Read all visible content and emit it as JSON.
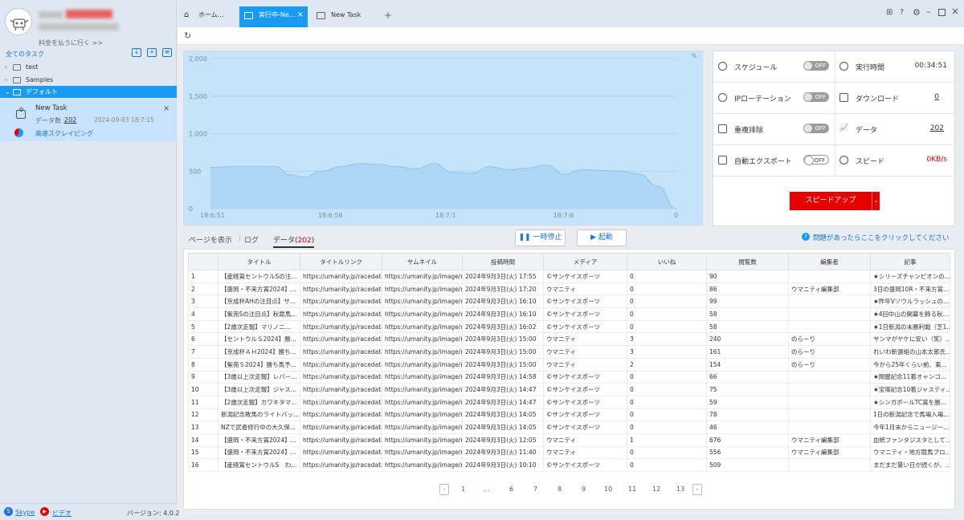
{
  "sidebar": {
    "pay_link": "料金を払うに行く >>",
    "all_tasks": "全てのタスク",
    "tree": [
      {
        "label": "test"
      },
      {
        "label": "Samples"
      },
      {
        "label": "デフォルト"
      }
    ],
    "task": {
      "name": "New Task",
      "data_label": "データ数 :",
      "data_count": "202",
      "timestamp": "2024-09-03 18:7:15",
      "mode": "高速スクレイピング"
    },
    "footer": {
      "skype": "Skype",
      "video": "ビデオ",
      "version": "バージョン: 4.0.2"
    }
  },
  "tabs": [
    {
      "label": "ホーム..."
    },
    {
      "label": "実行中-Ne..."
    },
    {
      "label": "New Task"
    }
  ],
  "stats": {
    "schedule": {
      "label": "スケジュール",
      "toggle": "OFF"
    },
    "runtime": {
      "label": "実行時間",
      "value": "00:34:51"
    },
    "ip_rotation": {
      "label": "IPローテーション",
      "toggle": "OFF"
    },
    "download": {
      "label": "ダウンロード",
      "value": "0"
    },
    "dedupe": {
      "label": "重複排除",
      "toggle": "OFF"
    },
    "data": {
      "label": "データ",
      "value": "202"
    },
    "auto_export": {
      "label": "自動エクスポート",
      "toggle": "OFF"
    },
    "speed": {
      "label": "スピード",
      "value": "0KB/s"
    },
    "speedup_button": "スピードアップ"
  },
  "subtabs": {
    "show_page": "ページを表示",
    "log": "ログ",
    "data_prefix": "データ(",
    "data_count": "202",
    "data_suffix": ")",
    "pause": "一時停止",
    "start": "起動",
    "help": "問題があったらここをクリックしてください"
  },
  "table": {
    "headers": [
      "",
      "タイトル",
      "タイトルリンク",
      "サムネイル",
      "投稿時間",
      "メディア",
      "いいね",
      "閲覧数",
      "編集者",
      "記事"
    ],
    "rows": [
      [
        "1",
        "【産経賞セントウルSの注...",
        "https://umanity.jp/racedata/...",
        "https://umanity.jp/image/ne...",
        "2024年9月3日(火) 17:55",
        "©サンケイスポーツ",
        "0",
        "90",
        "",
        "★シリーズチャンピオンの..."
      ],
      [
        "2",
        "【盛岡・不来方賞2024】...",
        "https://umanity.jp/racedata/...",
        "https://umanity.jp/image/ne...",
        "2024年9月3日(火) 17:20",
        "ウマニティ",
        "0",
        "86",
        "ウマニティ編集部",
        "3日の盛岡10R・不来方賞..."
      ],
      [
        "3",
        "【京成杯AHの注目点】サ...",
        "https://umanity.jp/racedata/...",
        "https://umanity.jp/image/ne...",
        "2024年9月3日(火) 16:10",
        "©サンケイスポーツ",
        "0",
        "99",
        "",
        "★昨年Vソウルラッシュの..."
      ],
      [
        "4",
        "【紫苑Sの注目点】秋競馬...",
        "https://umanity.jp/racedata/...",
        "https://umanity.jp/image/ne...",
        "2024年9月3日(火) 16:10",
        "©サンケイスポーツ",
        "0",
        "58",
        "",
        "★4回中山の開幕を飾る秋..."
      ],
      [
        "5",
        "【2歳次走報】マリノニ...",
        "https://umanity.jp/racedata/...",
        "https://umanity.jp/image/ne...",
        "2024年9月3日(火) 16:02",
        "©サンケイスポーツ",
        "0",
        "58",
        "",
        "★1日新潟の未勝利戦（芝1..."
      ],
      [
        "6",
        "【セントウルＳ2024】勝...",
        "https://umanity.jp/racedata/...",
        "https://umanity.jp/image/ne...",
        "2024年9月3日(火) 15:00",
        "ウマニティ",
        "3",
        "240",
        "のらーり",
        "サンマがヤケに安い（笑）..."
      ],
      [
        "7",
        "【京成杯ＡＨ2024】勝ち...",
        "https://umanity.jp/racedata/...",
        "https://umanity.jp/image/ne...",
        "2024年9月3日(火) 15:00",
        "ウマニティ",
        "3",
        "161",
        "のらーり",
        "れいわ新選組の山本太郎氏..."
      ],
      [
        "8",
        "【紫苑Ｓ2024】勝ち馬予...",
        "https://umanity.jp/racedata/...",
        "https://umanity.jp/image/ne...",
        "2024年9月3日(火) 15:00",
        "ウマニティ",
        "2",
        "154",
        "のらーり",
        "今から25年くらい前、東..."
      ],
      [
        "9",
        "【3歳以上次走報】レパー...",
        "https://umanity.jp/racedata/...",
        "https://umanity.jp/image/ne...",
        "2024年9月3日(火) 14:58",
        "©サンケイスポーツ",
        "0",
        "66",
        "",
        "★関屋記念11着オャンコ..."
      ],
      [
        "10",
        "【3歳以上次走報】ジャス...",
        "https://umanity.jp/racedata/...",
        "https://umanity.jp/image/ne...",
        "2024年9月3日(火) 14:47",
        "©サンケイスポーツ",
        "0",
        "75",
        "",
        "★宝塚記念10着ジャスティ..."
      ],
      [
        "11",
        "【2歳次走報】カワキタマ...",
        "https://umanity.jp/racedata/...",
        "https://umanity.jp/image/ne...",
        "2024年9月3日(火) 14:47",
        "©サンケイスポーツ",
        "0",
        "59",
        "",
        "★シンガポールTC賞を勝..."
      ],
      [
        "12",
        "新潟記念敗馬のライトバッ...",
        "https://umanity.jp/racedata/...",
        "https://umanity.jp/image/ne...",
        "2024年9月3日(火) 14:05",
        "©サンケイスポーツ",
        "0",
        "78",
        "",
        "1日の新潟記念で馬場入場..."
      ],
      [
        "13",
        "NZで武者修行中の大久保...",
        "https://umanity.jp/racedata/...",
        "https://umanity.jp/image/ne...",
        "2024年9月3日(火) 14:05",
        "©サンケイスポーツ",
        "0",
        "46",
        "",
        "今年1月末からニュージー..."
      ],
      [
        "14",
        "【盛岡・不来方賞2024】...",
        "https://umanity.jp/racedata/...",
        "https://umanity.jp/image/ne...",
        "2024年9月3日(火) 12:05",
        "ウマニティ",
        "1",
        "676",
        "ウマニティ編集部",
        "血統ファンタジスタとして..."
      ],
      [
        "15",
        "【盛岡・不来方賞2024】...",
        "https://umanity.jp/racedata/...",
        "https://umanity.jp/image/ne...",
        "2024年9月3日(火) 11:40",
        "ウマニティ",
        "0",
        "556",
        "ウマニティ編集部",
        "ウマニティ・地方競馬プロ..."
      ],
      [
        "16",
        "【産経賞セントウルS　わ...",
        "https://umanity.jp/racedata/...",
        "https://umanity.jp/image/ne...",
        "2024年9月3日(火) 10:10",
        "©サンケイスポーツ",
        "0",
        "509",
        "",
        "まだまだ暑い日が続くが、..."
      ]
    ]
  },
  "pager": {
    "pages": [
      "1",
      "...",
      "6",
      "7",
      "8",
      "9",
      "10",
      "11",
      "12",
      "13"
    ],
    "current": "1"
  },
  "colors": {
    "accent": "#1a9bf3",
    "speedup": "#e60000",
    "chart_fill": "#a9d3f5"
  },
  "chart_data": {
    "type": "area",
    "x_ticks": [
      "18:6:51",
      "18:6:56",
      "18:7:1",
      "18:7:6",
      "0"
    ],
    "y_ticks": [
      "2,000",
      "1,500",
      "1,000",
      "500",
      "0"
    ],
    "ylim": [
      0,
      2000
    ],
    "x": [
      0,
      0.05,
      0.1,
      0.14,
      0.17,
      0.2,
      0.24,
      0.28,
      0.32,
      0.36,
      0.4,
      0.44,
      0.48,
      0.52,
      0.56,
      0.6,
      0.64,
      0.68,
      0.72,
      0.76,
      0.8,
      0.84,
      0.88,
      0.92,
      0.96,
      1.0
    ],
    "values": [
      550,
      560,
      560,
      560,
      450,
      420,
      500,
      560,
      600,
      590,
      560,
      530,
      600,
      480,
      470,
      560,
      520,
      540,
      580,
      460,
      520,
      510,
      500,
      460,
      300,
      0
    ]
  }
}
